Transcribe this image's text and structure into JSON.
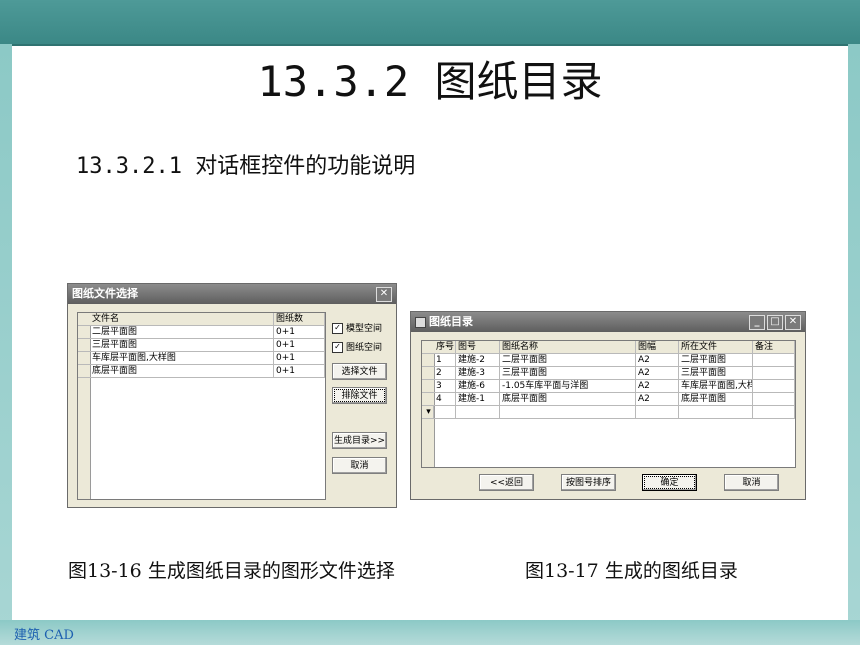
{
  "slide": {
    "title": "13.3.2 图纸目录",
    "subtitle": "13.3.2.1  对话框控件的功能说明",
    "caption_left": "图13-16  生成图纸目录的图形文件选择",
    "caption_right": "图13-17  生成的图纸目录",
    "footer": "建筑 CAD"
  },
  "dialog1": {
    "title": "图纸文件选择",
    "columns": [
      "文件名",
      "图纸数"
    ],
    "rows": [
      [
        "二层平面图",
        "0+1"
      ],
      [
        "三层平面图",
        "0+1"
      ],
      [
        "车库层平面图,大样图",
        "0+1"
      ],
      [
        "底层平面图",
        "0+1"
      ]
    ],
    "check_model": "模型空间",
    "check_paper": "图纸空间",
    "btn_select": "选择文件",
    "btn_remove": "排除文件",
    "btn_generate": "生成目录>>",
    "btn_cancel": "取消"
  },
  "dialog2": {
    "title": "图纸目录",
    "columns": [
      "序号",
      "图号",
      "图纸名称",
      "图幅",
      "所在文件",
      "备注"
    ],
    "rows": [
      [
        "1",
        "建施-2",
        "二层平面图",
        "A2",
        "二层平面图",
        ""
      ],
      [
        "2",
        "建施-3",
        "三层平面图",
        "A2",
        "三层平面图",
        ""
      ],
      [
        "3",
        "建施-6",
        "-1.05车库平面与洋图",
        "A2",
        "车库层平面图,大样",
        ""
      ],
      [
        "4",
        "建施-1",
        "底层平面图",
        "A2",
        "底层平面图",
        ""
      ]
    ],
    "btn_back": "<<返回",
    "btn_sort": "按图号排序",
    "btn_ok": "确定",
    "btn_cancel": "取消"
  }
}
